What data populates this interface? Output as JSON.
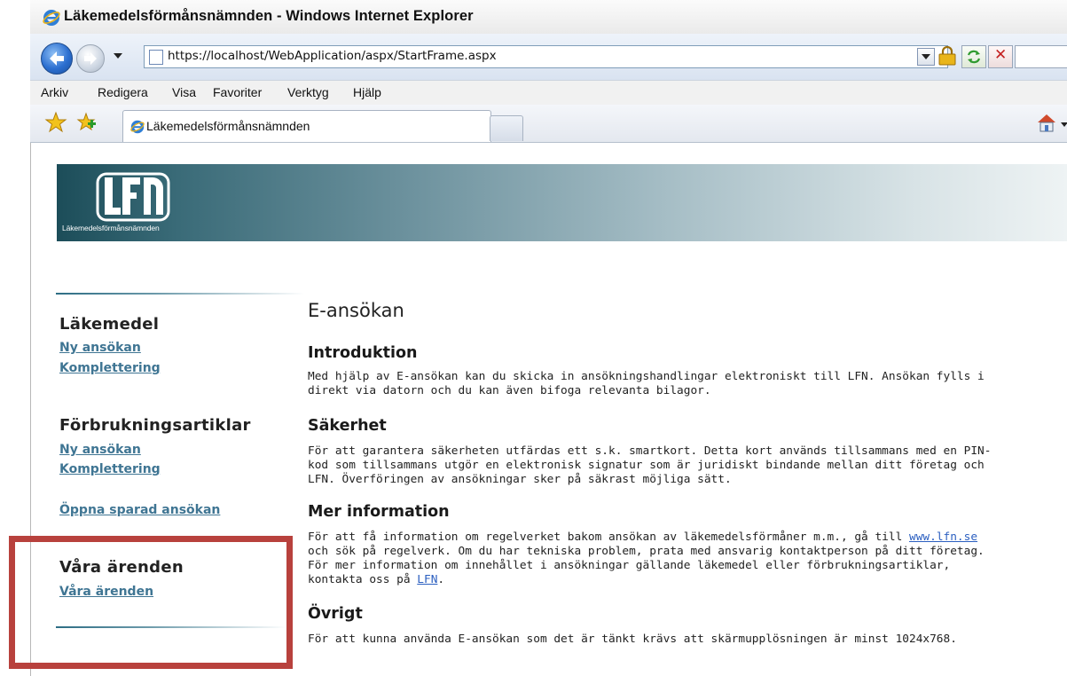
{
  "window": {
    "title": "Läkemedelsförmånsnämnden - Windows Internet Explorer"
  },
  "address": {
    "url": "https://localhost/WebApplication/aspx/StartFrame.aspx"
  },
  "menu": [
    "Arkiv",
    "Redigera",
    "Visa",
    "Favoriter",
    "Verktyg",
    "Hjälp"
  ],
  "tab": {
    "label": "Läkemedelsförmånsnämnden"
  },
  "banner": {
    "logo": "LFN",
    "logo_text": "Läkemedelsförmånsnämnden"
  },
  "sidebar": {
    "sections": [
      {
        "heading": "Läkemedel",
        "links": [
          "Ny ansökan",
          "Komplettering"
        ]
      },
      {
        "heading": "Förbrukningsartiklar",
        "links": [
          "Ny ansökan",
          "Komplettering"
        ]
      },
      {
        "heading": "",
        "links": [
          "Öppna sparad ansökan"
        ]
      },
      {
        "heading": "Våra ärenden",
        "links": [
          "Våra ärenden"
        ]
      }
    ]
  },
  "content": {
    "title": "E-ansökan",
    "sections": [
      {
        "heading": "Introduktion",
        "lines": [
          "Med hjälp av E-ansökan kan du skicka in ansökningshandlingar elektroniskt till LFN. Ansökan fylls i",
          "direkt via datorn och du kan även bifoga relevanta bilagor."
        ]
      },
      {
        "heading": "Säkerhet",
        "lines": [
          "För att garantera säkerheten utfärdas ett s.k. smartkort. Detta kort används tillsammans med en PIN-",
          "kod som tillsammans utgör en elektronisk signatur som är juridiskt bindande mellan ditt företag och",
          "LFN. Överföringen av ansökningar sker på säkrast möjliga sätt."
        ]
      },
      {
        "heading": "Mer information",
        "line1_pre": "För att få information om regelverket bakom ansökan av läkemedelsförmåner m.m., gå till ",
        "link1": "www.lfn.se",
        "line2": "och sök på regelverk. Om du har tekniska problem, prata med ansvarig kontaktperson på ditt företag.",
        "line3": "För mer information om innehållet i ansökningar gällande läkemedel eller förbrukningsartiklar,",
        "line4_pre": "kontakta oss på ",
        "link2": "LFN",
        "line4_post": "."
      },
      {
        "heading": "Övrigt",
        "lines": [
          "För att kunna använda E-ansökan som det är tänkt krävs att skärmupplösningen är minst 1024x768."
        ]
      }
    ]
  },
  "colors": {
    "highlight": "#b8413d",
    "link": "#3f7593",
    "banner_dark": "#1c4d59"
  }
}
